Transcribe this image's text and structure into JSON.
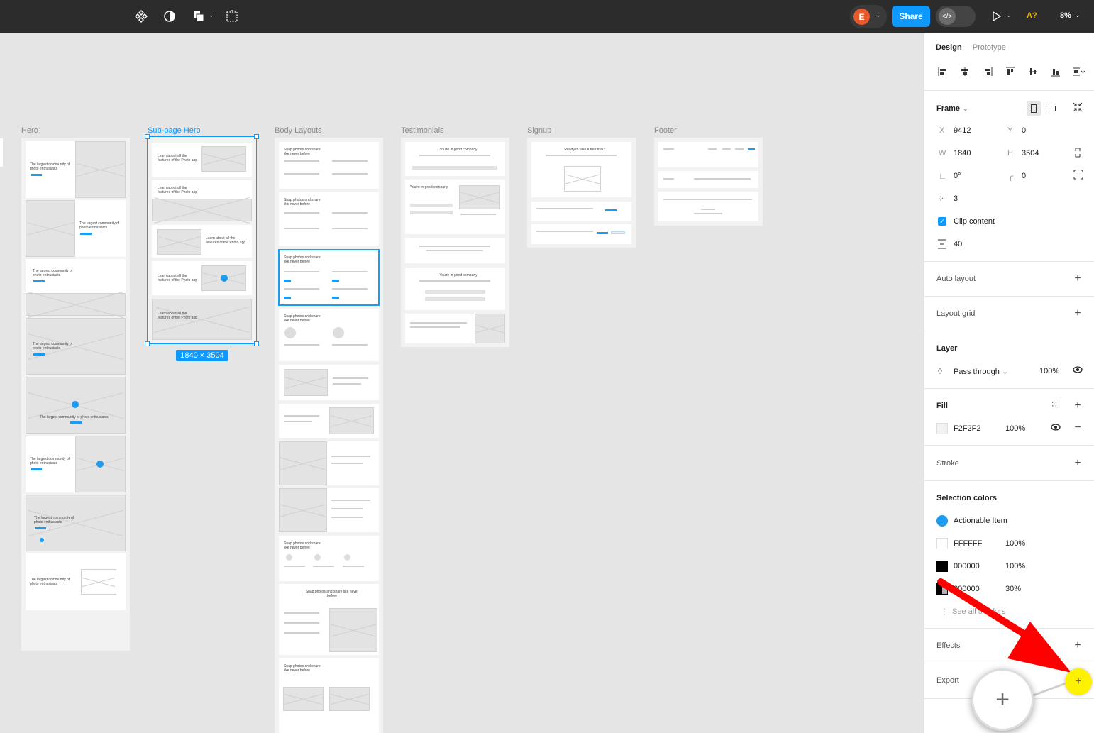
{
  "toolbar": {
    "avatar_initial": "E",
    "share_label": "Share",
    "dev_mode_icon": "code-icon",
    "font_warning": "A?",
    "zoom": "8%"
  },
  "canvas": {
    "frames": {
      "hero": "Hero",
      "subpage_hero": "Sub-page Hero",
      "body_layouts": "Body Layouts",
      "testimonials": "Testimonials",
      "signup": "Signup",
      "footer": "Footer"
    },
    "selection_size": "1840 × 3504",
    "hero_text": "The largest community of photo enthusiasts",
    "subhero_text": "Learn about all the features of the Photo app",
    "body_text": "Snap photos and share like never before",
    "testimonial_text": "You're in good company",
    "signup_text": "Ready to take a free trial?"
  },
  "panel": {
    "tabs": [
      "Design",
      "Prototype"
    ],
    "frame": {
      "title": "Frame",
      "x_label": "X",
      "x": "9412",
      "y_label": "Y",
      "y": "0",
      "w_label": "W",
      "w": "1840",
      "h_label": "H",
      "h": "3504",
      "rotation": "0°",
      "radius": "0",
      "corner_count": "3",
      "clip_label": "Clip content",
      "spacing": "40"
    },
    "auto_layout": "Auto layout",
    "layout_grid": "Layout grid",
    "layer": {
      "title": "Layer",
      "blend": "Pass through",
      "opacity": "100%"
    },
    "fill": {
      "title": "Fill",
      "hex": "F2F2F2",
      "opacity": "100%"
    },
    "stroke": "Stroke",
    "selection_colors": {
      "title": "Selection colors",
      "items": [
        {
          "name": "Actionable Item",
          "color": "#1d9bf0"
        },
        {
          "name": "FFFFFF",
          "opacity": "100%",
          "color": "#FFFFFF"
        },
        {
          "name": "000000",
          "opacity": "100%",
          "color": "#000000"
        },
        {
          "name": "000000",
          "opacity": "30%",
          "color": "#000000"
        }
      ],
      "see_all": "See all 5 colors"
    },
    "effects": "Effects",
    "export": "Export"
  },
  "colors": {
    "accent": "#0d99ff",
    "annotation_arrow": "#ff0000",
    "highlight": "#fff200"
  }
}
